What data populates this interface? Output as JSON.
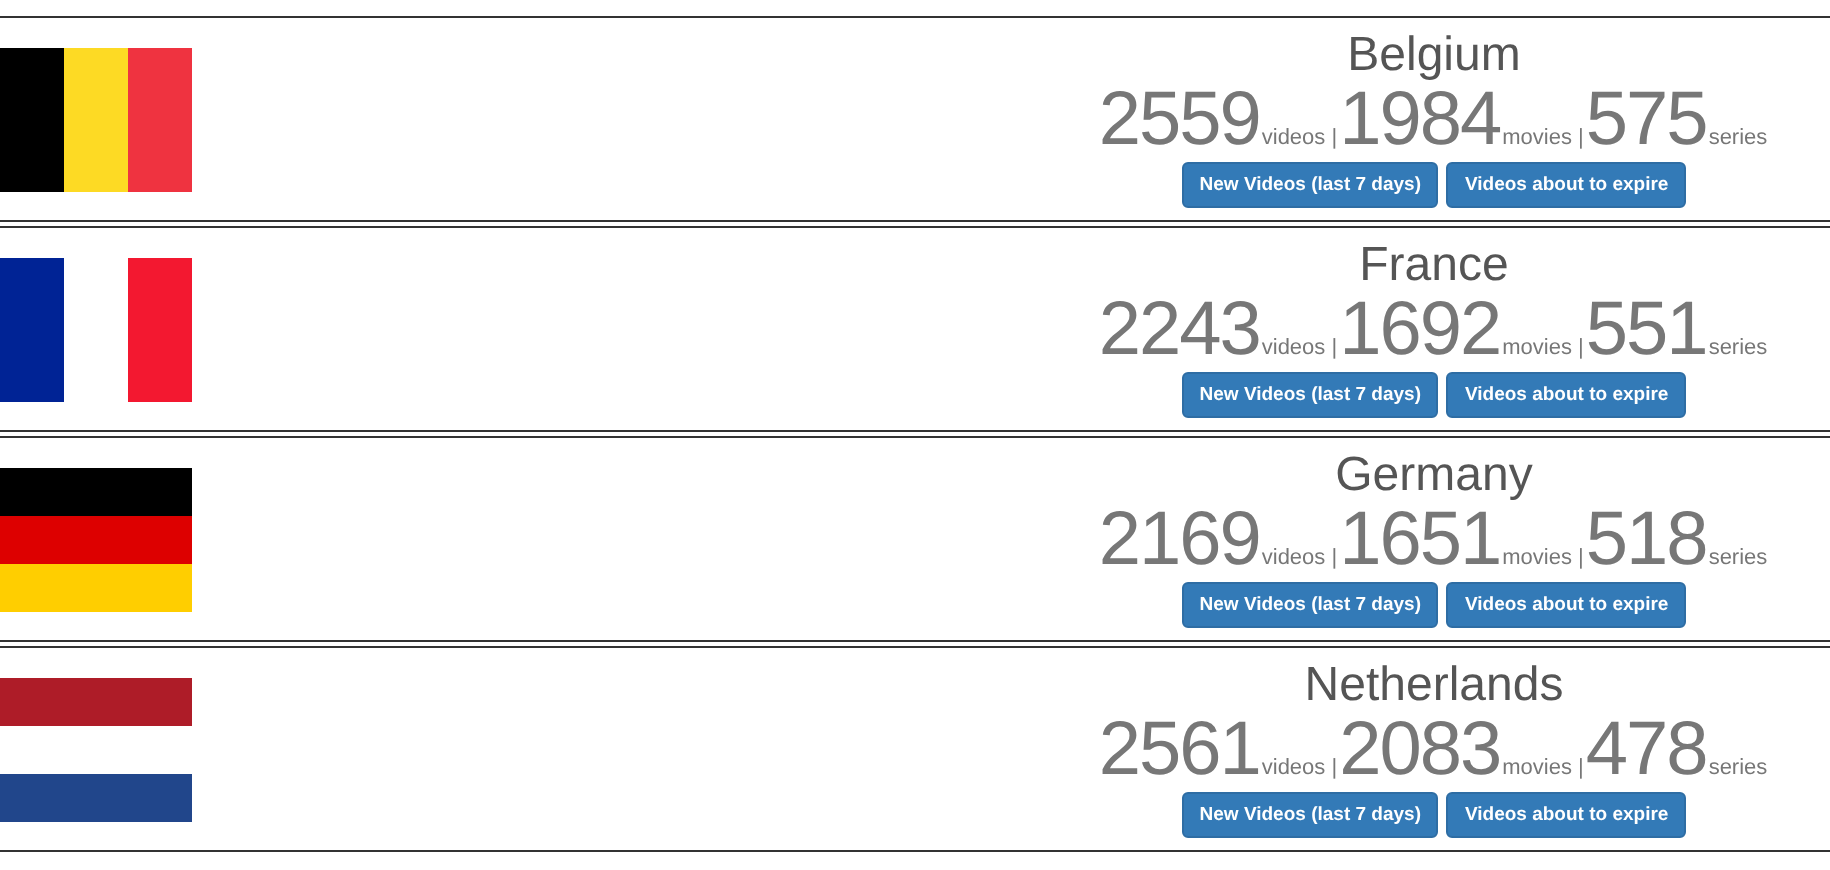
{
  "countries": [
    {
      "name": "Belgium",
      "flag": {
        "kind": "vertical",
        "stripes": [
          {
            "color": "#000000"
          },
          {
            "color": "#fdda24"
          },
          {
            "color": "#ef3340"
          }
        ]
      },
      "stats": [
        {
          "number": "2559",
          "label": "videos |"
        },
        {
          "number": "1984",
          "label": "movies |"
        },
        {
          "number": "575",
          "label": "series"
        }
      ],
      "buttons": [
        "New Videos (last 7 days)",
        "Videos about to expire"
      ]
    },
    {
      "name": "France",
      "flag": {
        "kind": "vertical",
        "stripes": [
          {
            "color": "#002395"
          },
          {
            "kind": "blank"
          },
          {
            "color": "#f31830"
          }
        ]
      },
      "stats": [
        {
          "number": "2243",
          "label": "videos |"
        },
        {
          "number": "1692",
          "label": "movies |"
        },
        {
          "number": "551",
          "label": "series"
        }
      ],
      "buttons": [
        "New Videos (last 7 days)",
        "Videos about to expire"
      ]
    },
    {
      "name": "Germany",
      "flag": {
        "kind": "horizontal",
        "stripes": [
          {
            "color": "#000000"
          },
          {
            "color": "#dd0000"
          },
          {
            "color": "#ffce00"
          }
        ]
      },
      "stats": [
        {
          "number": "2169",
          "label": "videos |"
        },
        {
          "number": "1651",
          "label": "movies |"
        },
        {
          "number": "518",
          "label": "series"
        }
      ],
      "buttons": [
        "New Videos (last 7 days)",
        "Videos about to expire"
      ]
    },
    {
      "name": "Netherlands",
      "flag": {
        "kind": "horizontal",
        "stripes": [
          {
            "color": "#ae1c28"
          },
          {
            "kind": "blank"
          },
          {
            "color": "#21468b"
          }
        ]
      },
      "stats": [
        {
          "number": "2561",
          "label": "videos |"
        },
        {
          "number": "2083",
          "label": "movies |"
        },
        {
          "number": "478",
          "label": "series"
        }
      ],
      "buttons": [
        "New Videos (last 7 days)",
        "Videos about to expire"
      ]
    }
  ]
}
